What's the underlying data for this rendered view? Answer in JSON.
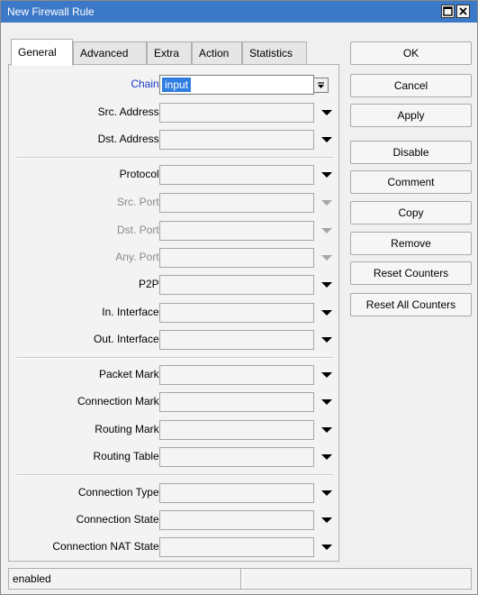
{
  "window": {
    "title": "New Firewall Rule",
    "titlebar_color": "#3c78c8"
  },
  "tabs": [
    {
      "label": "General",
      "active": true
    },
    {
      "label": "Advanced",
      "active": false
    },
    {
      "label": "Extra",
      "active": false
    },
    {
      "label": "Action",
      "active": false
    },
    {
      "label": "Statistics",
      "active": false
    }
  ],
  "form": {
    "chain": {
      "label": "Chain:",
      "value": "input"
    },
    "src_address": {
      "label": "Src. Address:"
    },
    "dst_address": {
      "label": "Dst. Address:"
    },
    "protocol": {
      "label": "Protocol:"
    },
    "src_port": {
      "label": "Src. Port:"
    },
    "dst_port": {
      "label": "Dst. Port:"
    },
    "any_port": {
      "label": "Any. Port:"
    },
    "p2p": {
      "label": "P2P:"
    },
    "in_interface": {
      "label": "In. Interface:"
    },
    "out_interface": {
      "label": "Out. Interface:"
    },
    "packet_mark": {
      "label": "Packet Mark:"
    },
    "connection_mark": {
      "label": "Connection Mark:"
    },
    "routing_mark": {
      "label": "Routing Mark:"
    },
    "routing_table": {
      "label": "Routing Table:"
    },
    "connection_type": {
      "label": "Connection Type:"
    },
    "connection_state": {
      "label": "Connection State:"
    },
    "connection_nat_state": {
      "label": "Connection NAT State:"
    }
  },
  "buttons": {
    "ok": "OK",
    "cancel": "Cancel",
    "apply": "Apply",
    "disable": "Disable",
    "comment": "Comment",
    "copy": "Copy",
    "remove": "Remove",
    "reset_counters": "Reset Counters",
    "reset_all_counters": "Reset All Counters"
  },
  "status": {
    "text": "enabled"
  }
}
